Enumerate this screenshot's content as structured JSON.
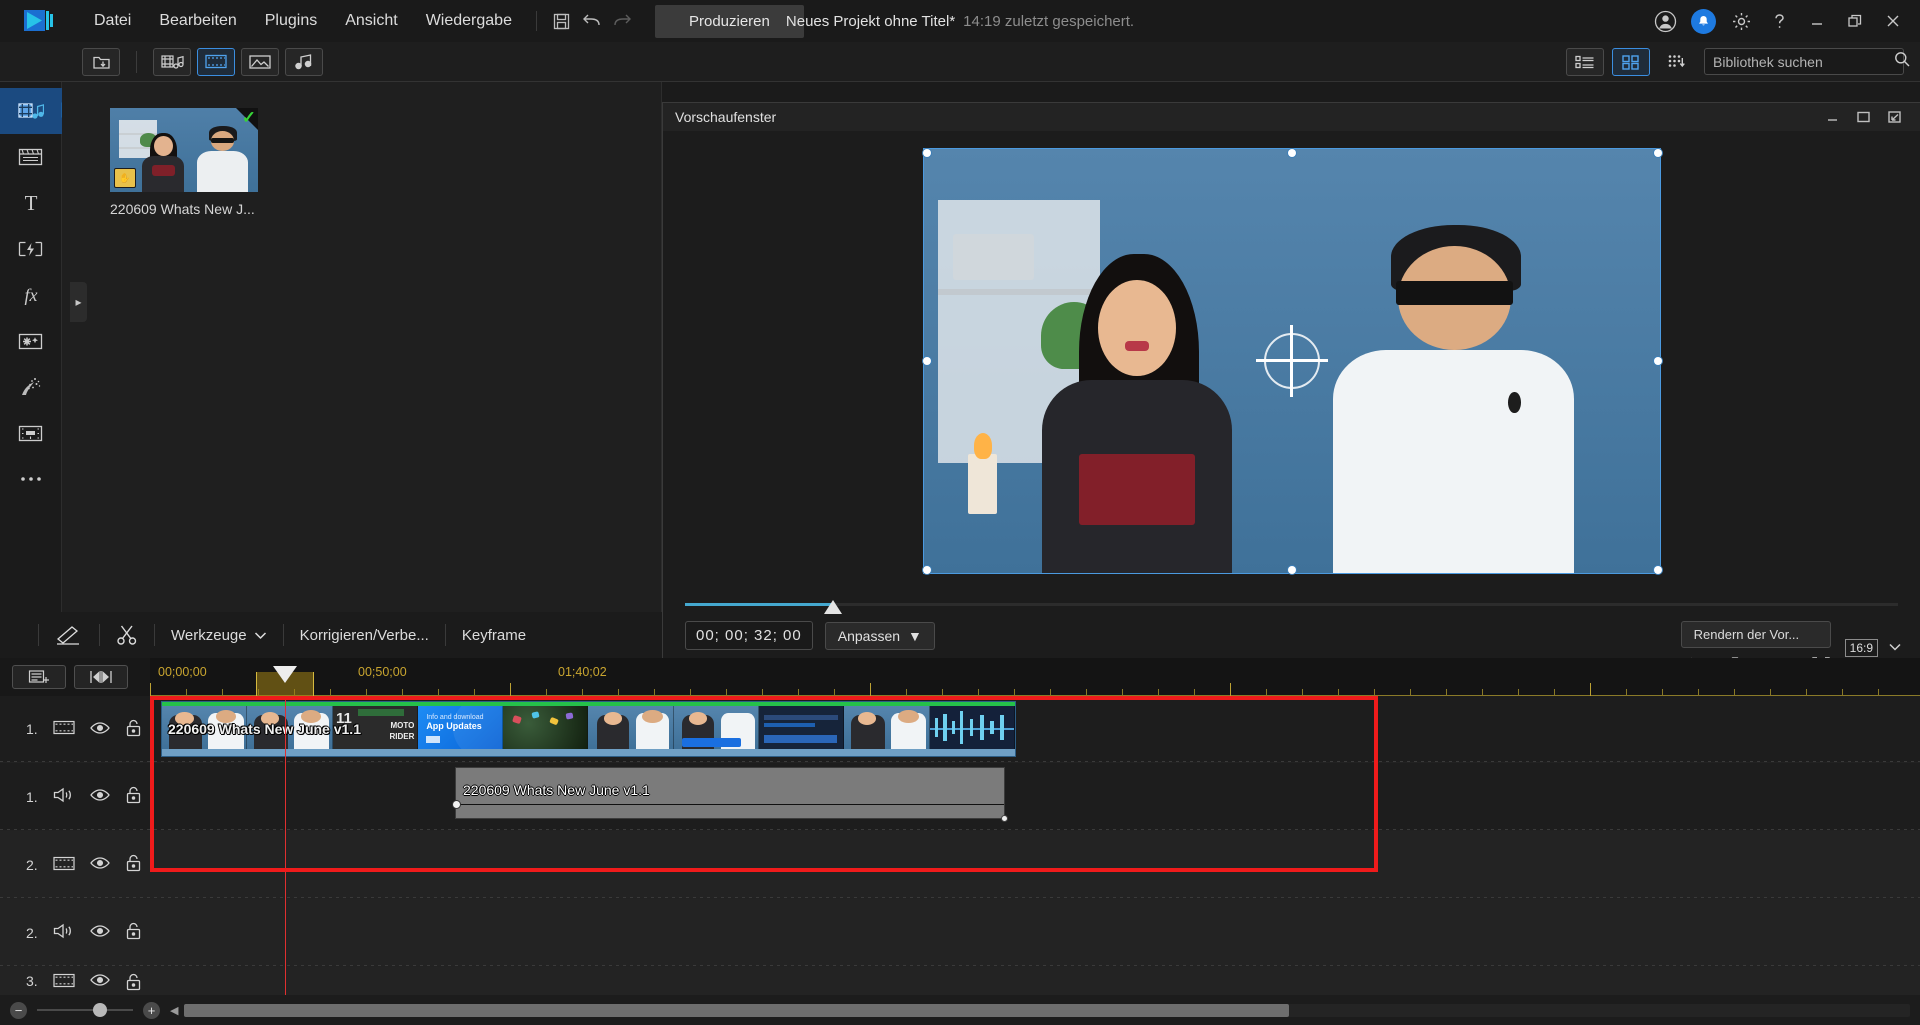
{
  "app": {
    "logo_icon": "powerdirector-logo-icon"
  },
  "titlebar": {
    "menus": [
      "Datei",
      "Bearbeiten",
      "Plugins",
      "Ansicht",
      "Wiedergabe"
    ],
    "save_icon": "save-icon",
    "undo_icon": "undo-icon",
    "redo_icon": "redo-icon",
    "produce_label": "Produzieren",
    "project_name": "Neues Projekt ohne Titel*",
    "saved_status": "14:19 zuletzt gespeichert.",
    "account_icon": "account-icon",
    "notification_icon": "bell-icon",
    "settings_icon": "gear-icon",
    "help_icon": "help-icon",
    "minimize_icon": "minimize-icon",
    "restore_icon": "restore-icon",
    "close_icon": "close-icon"
  },
  "library_toolbar": {
    "import_icon": "import-media-icon",
    "filters": [
      {
        "name": "all-media",
        "icon": "film-music-icon",
        "selected": false
      },
      {
        "name": "video-only",
        "icon": "video-icon",
        "selected": true
      },
      {
        "name": "image-only",
        "icon": "image-icon",
        "selected": false
      },
      {
        "name": "audio-only",
        "icon": "music-icon",
        "selected": false
      }
    ],
    "list_view_icon": "list-view-icon",
    "grid_view_icon": "grid-view-icon",
    "sort_icon": "sort-icon",
    "search_placeholder": "Bibliothek suchen",
    "search_value": "",
    "search_icon": "search-icon"
  },
  "sidebar": {
    "items": [
      {
        "name": "media-room",
        "icon": "film-music-icon",
        "active": true
      },
      {
        "name": "title-room-board",
        "icon": "clapperboard-icon",
        "active": false
      },
      {
        "name": "title-room",
        "icon": "letter-t-icon",
        "active": false
      },
      {
        "name": "transition-room",
        "icon": "transition-icon",
        "active": false
      },
      {
        "name": "effect-room",
        "icon": "fx-icon",
        "active": false
      },
      {
        "name": "overlay-room",
        "icon": "star-frame-icon",
        "active": false
      },
      {
        "name": "particle-room",
        "icon": "particle-icon",
        "active": false
      },
      {
        "name": "subtitle-room",
        "icon": "subtitle-icon",
        "active": false
      },
      {
        "name": "more-rooms",
        "icon": "ellipsis-icon",
        "active": false
      }
    ],
    "expander_icon": "chevron-right-icon"
  },
  "library": {
    "items": [
      {
        "label": "220609 Whats New J...",
        "selected_icon": "green-check-icon",
        "badge_icon": "hand-badge-icon"
      }
    ]
  },
  "preview": {
    "title": "Vorschaufenster",
    "minimize_icon": "minimize-icon",
    "maximize_icon": "maximize-icon",
    "popout_icon": "popout-icon",
    "crosshair_icon": "move-crosshair-icon",
    "seek_percent": 12,
    "timecode": "00; 00; 32; 00",
    "fit_label": "Anpassen",
    "fit_caret_icon": "chevron-down-icon",
    "transport": [
      {
        "name": "play-button",
        "icon": "play-icon"
      },
      {
        "name": "stop-button",
        "icon": "stop-icon"
      },
      {
        "name": "previous-frame-button",
        "icon": "prev-frame-icon"
      },
      {
        "name": "marker-button",
        "icon": "marker-icon"
      },
      {
        "name": "next-frame-button",
        "icon": "next-frame-icon"
      },
      {
        "name": "fast-forward-button",
        "icon": "fast-forward-icon"
      }
    ],
    "render_preview_label": "Rendern der Vor...",
    "icons": [
      {
        "name": "volume-button",
        "icon": "speaker-icon"
      },
      {
        "name": "snapshot-button",
        "icon": "camera-icon"
      },
      {
        "name": "preview-settings-button",
        "icon": "list-settings-icon"
      },
      {
        "name": "fullscreen-button",
        "icon": "fullscreen-icon"
      }
    ],
    "aspect_ratio": "16:9",
    "aspect_caret_icon": "chevron-down-icon"
  },
  "timeline_toolbar": {
    "buttons": [
      {
        "name": "magic-designer-button",
        "label": "",
        "icon": "pencil-wand-icon"
      },
      {
        "name": "split-button",
        "label": "",
        "icon": "scissors-icon"
      },
      {
        "name": "tools-button",
        "label": "Werkzeuge",
        "icon": "chevron-down-icon"
      },
      {
        "name": "fix-enhance-button",
        "label": "Korrigieren/Verbe...",
        "icon": ""
      },
      {
        "name": "keyframe-button",
        "label": "Keyframe",
        "icon": ""
      }
    ]
  },
  "timeline": {
    "track_manager_icon": "track-manager-icon",
    "marker_icon": "timeline-marker-icon",
    "ruler_labels": [
      "00;00;00",
      "00;50;00",
      "01;40;02"
    ],
    "playhead_position_percent": 8,
    "tracks": [
      {
        "number": "1.",
        "type": "video",
        "icon": "video-track-icon",
        "eye_icon": "eye-icon",
        "lock_icon": "unlock-icon"
      },
      {
        "number": "1.",
        "type": "audio",
        "icon": "audio-track-icon",
        "eye_icon": "eye-icon",
        "lock_icon": "unlock-icon"
      },
      {
        "number": "2.",
        "type": "video",
        "icon": "video-track-icon",
        "eye_icon": "eye-icon",
        "lock_icon": "unlock-icon"
      },
      {
        "number": "2.",
        "type": "audio",
        "icon": "audio-track-icon",
        "eye_icon": "eye-icon",
        "lock_icon": "unlock-icon"
      },
      {
        "number": "3.",
        "type": "video",
        "icon": "video-track-icon",
        "eye_icon": "eye-icon",
        "lock_icon": "unlock-icon"
      }
    ],
    "video_clip": {
      "label": "220609 Whats New June v1.1"
    },
    "audio_clip": {
      "label": "220609 Whats New June v1.1"
    },
    "highlight_color": "#ef1b1b"
  },
  "bottombar": {
    "zoom_out_icon": "minus-icon",
    "zoom_in_icon": "plus-icon",
    "zoom_value_percent": 58,
    "scroll_left_icon": "caret-left-icon"
  },
  "colors": {
    "accent": "#1e7ae0",
    "selection": "#3b8ee0",
    "highlight": "#ef1b1b",
    "ruler_text": "#c9a52f",
    "clip_video": "#6f9fc4",
    "clip_audio": "#7b7b7b"
  }
}
